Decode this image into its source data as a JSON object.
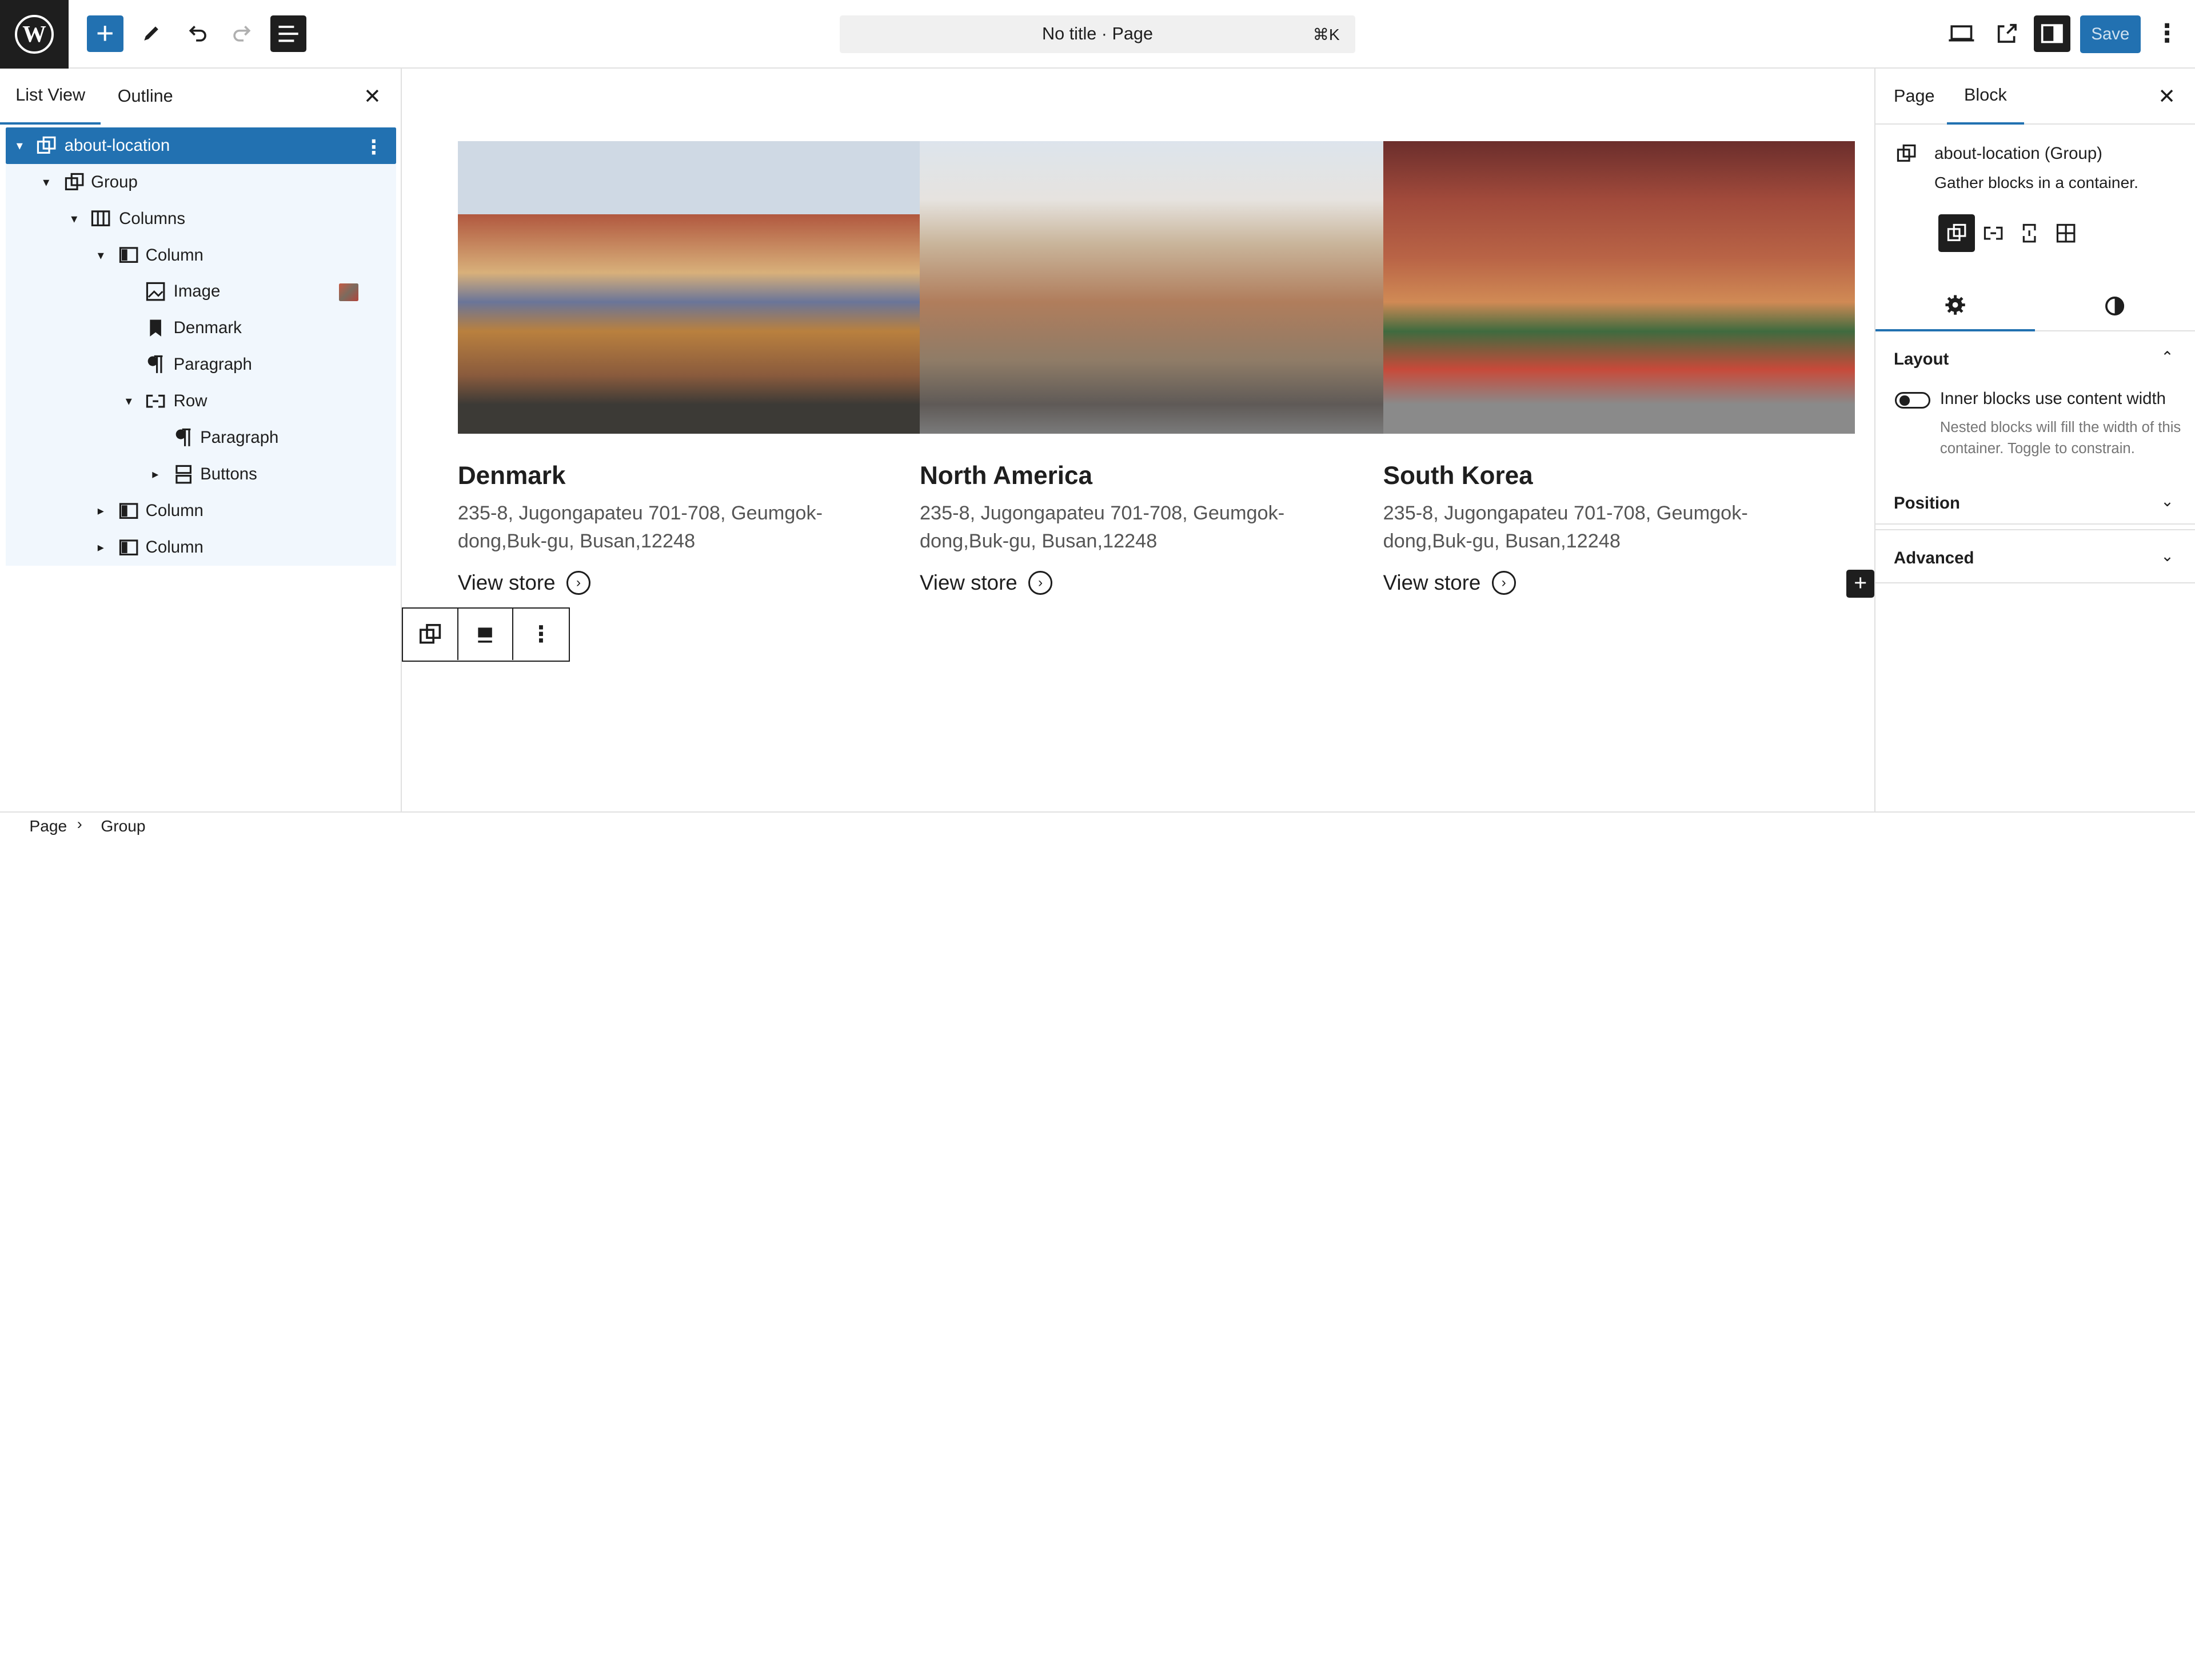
{
  "topbar": {
    "logo": "W",
    "add_icon": "+",
    "command": {
      "title": "No title · Page",
      "shortcut": "⌘K"
    },
    "save_label": "Save",
    "more_icon": "⋮"
  },
  "left_panel": {
    "tabs": [
      "List View",
      "Outline"
    ],
    "close_icon": "✕",
    "tree": [
      {
        "label": "about-location",
        "icon": "group-icon",
        "selected": true
      },
      {
        "label": "Group",
        "icon": "group-icon"
      },
      {
        "label": "Columns",
        "icon": "columns-icon"
      },
      {
        "label": "Column",
        "icon": "column-icon"
      },
      {
        "label": "Image",
        "icon": "image-icon"
      },
      {
        "label": "Denmark",
        "icon": "heading-icon"
      },
      {
        "label": "Paragraph",
        "icon": "paragraph-icon"
      },
      {
        "label": "Row",
        "icon": "row-icon"
      },
      {
        "label": "Paragraph",
        "icon": "paragraph-icon"
      },
      {
        "label": "Buttons",
        "icon": "buttons-icon"
      },
      {
        "label": "Column",
        "icon": "column-icon"
      },
      {
        "label": "Column",
        "icon": "column-icon"
      }
    ]
  },
  "canvas": {
    "columns": [
      {
        "title": "Denmark",
        "address": "235-8, Jugongapateu 701-708, Geumgok-dong,Buk-gu, Busan,12248",
        "link": "View store"
      },
      {
        "title": "North America",
        "address": "235-8, Jugongapateu 701-708, Geumgok-dong,Buk-gu, Busan,12248",
        "link": "View store"
      },
      {
        "title": "South Korea",
        "address": "235-8, Jugongapateu 701-708, Geumgok-dong,Buk-gu, Busan,12248",
        "link": "View store"
      }
    ],
    "arrow": "›",
    "inserter": "+"
  },
  "right_panel": {
    "tabs": [
      "Page",
      "Block"
    ],
    "close_icon": "✕",
    "block_title": "about-location (Group)",
    "block_desc": "Gather blocks in a container.",
    "sections": {
      "layout": "Layout",
      "toggle_label": "Inner blocks use content width",
      "toggle_help": "Nested blocks will fill the width of this container. Toggle to constrain.",
      "position": "Position",
      "advanced": "Advanced"
    }
  },
  "footer": {
    "crumbs": [
      "Page",
      "Group"
    ]
  },
  "colors": {
    "accent": "#2271b1",
    "dark": "#1e1e1e",
    "selection_bg": "#f1f7fd"
  }
}
